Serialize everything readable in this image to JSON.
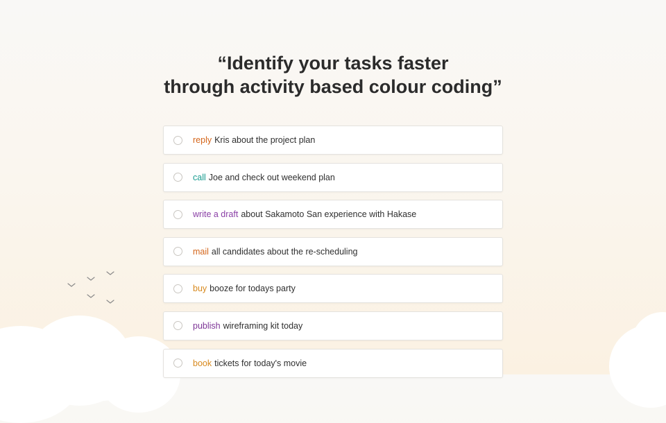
{
  "headline": {
    "line1": "“Identify your tasks faster",
    "line2": "through activity based colour coding”"
  },
  "tasks": [
    {
      "verb": "reply",
      "verb_color": "#d4651a",
      "text": "Kris about the project plan"
    },
    {
      "verb": "call",
      "verb_color": "#169b8f",
      "text": "Joe and check out weekend plan"
    },
    {
      "verb": "write a draft",
      "verb_color": "#8a3fa6",
      "text": "about Sakamoto San experience with Hakase"
    },
    {
      "verb": "mail",
      "verb_color": "#d4651a",
      "text": "all candidates about the re-scheduling"
    },
    {
      "verb": "buy",
      "verb_color": "#d88a1f",
      "text": "booze for todays party"
    },
    {
      "verb": "publish",
      "verb_color": "#7d3596",
      "text": "wireframing kit today"
    },
    {
      "verb": "book",
      "verb_color": "#d88a1f",
      "text": "tickets for today's movie"
    }
  ],
  "colors": {
    "heading": "#2b2b2b",
    "background_top": "#f9f8f6",
    "background_bottom": "#fbf1e2",
    "card_border": "#e4e2de"
  }
}
